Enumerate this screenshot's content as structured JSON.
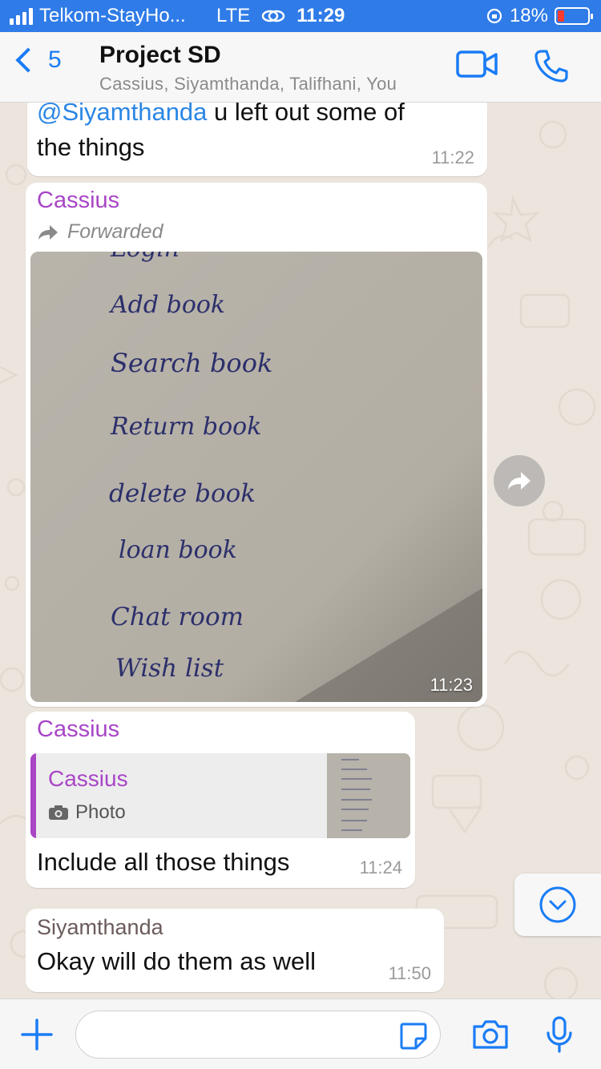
{
  "status_bar": {
    "carrier": "Telkom-StayHo...",
    "network": "LTE",
    "time": "11:29",
    "battery": "18%"
  },
  "header": {
    "back_count": "5",
    "title": "Project SD",
    "subtitle": "Cassius, Siyamthanda, Talifhani, You"
  },
  "messages": [
    {
      "mention": "@Siyamthanda",
      "text_line1": " u left out some of",
      "text_line2": "the things",
      "time": "11:22"
    },
    {
      "sender": "Cassius",
      "forwarded_label": "Forwarded",
      "photo_lines": [
        "Login",
        "Add book",
        "Search book",
        "Return book",
        "delete book",
        "loan book",
        "Chat room",
        "Wish list"
      ],
      "time": "11:23"
    },
    {
      "sender": "Cassius",
      "quote_sender": "Cassius",
      "quote_type": "Photo",
      "text": "Include all those things",
      "time": "11:24"
    },
    {
      "sender": "Siyamthanda",
      "text": "Okay will do them as well",
      "time": "11:50"
    }
  ],
  "colors": {
    "accent": "#1a7cf5",
    "status_bar": "#2f7be8",
    "sender_purple": "#a846c6",
    "mention_blue": "#2b86e4",
    "chat_bg": "#ece5dd"
  },
  "icons": {
    "video": "video-call-icon",
    "phone": "phone-call-icon",
    "add": "plus-icon",
    "sticker": "sticker-icon",
    "camera": "camera-icon",
    "mic": "microphone-icon"
  }
}
